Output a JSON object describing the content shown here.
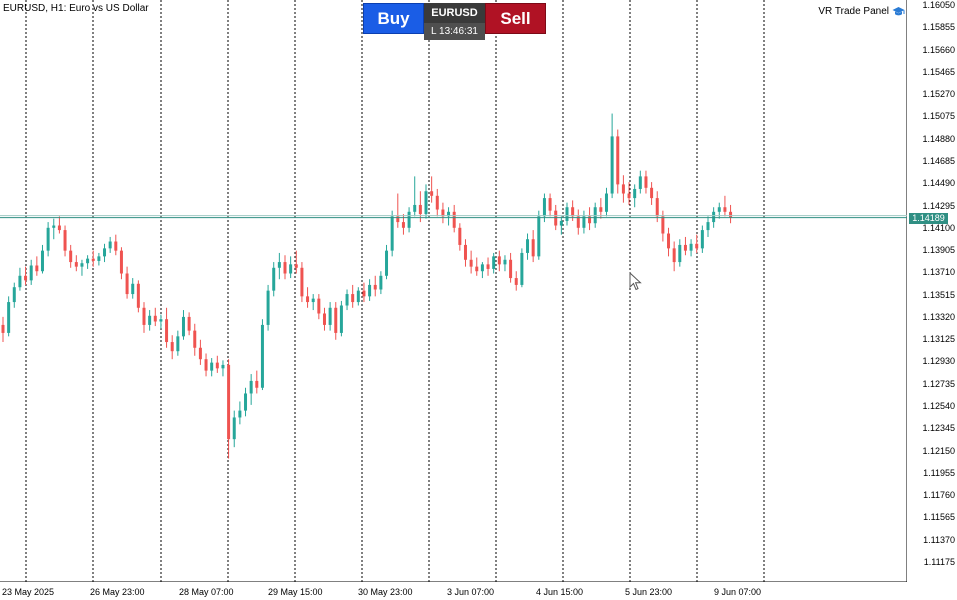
{
  "header": {
    "symbol_title": "EURUSD, H1:  Euro vs US Dollar",
    "panel_title": "VR Trade Panel",
    "panel_icon": "graduation-cap-icon"
  },
  "trade_panel": {
    "buy_label": "Buy",
    "sell_label": "Sell",
    "symbol": "EURUSD",
    "time": "L 13:46:31",
    "buy_color": "#1a5de6",
    "sell_color": "#b01224"
  },
  "price_axis": [
    "1.16050",
    "1.15855",
    "1.15660",
    "1.15465",
    "1.15270",
    "1.15075",
    "1.14880",
    "1.14685",
    "1.14490",
    "1.14295",
    "1.14100",
    "1.13905",
    "1.13710",
    "1.13515",
    "1.13320",
    "1.13125",
    "1.12930",
    "1.12735",
    "1.12540",
    "1.12345",
    "1.12150",
    "1.11955",
    "1.11760",
    "1.11565",
    "1.11370",
    "1.11175"
  ],
  "current_price": "1.14189",
  "current_price_color": "#2f8f83",
  "date_axis": [
    "23 May 2025",
    "26 May 23:00",
    "28 May 07:00",
    "29 May 15:00",
    "30 May 23:00",
    "3 Jun 07:00",
    "4 Jun 15:00",
    "5 Jun 23:00",
    "9 Jun 07:00"
  ],
  "chart_data": {
    "type": "candlestick",
    "symbol": "EURUSD",
    "timeframe": "H1",
    "bull_color": "#26a69a",
    "bear_color": "#ef5350",
    "ylim": [
      1.11,
      1.161
    ],
    "candles": [
      {
        "o": 1.1325,
        "h": 1.1332,
        "l": 1.131,
        "c": 1.1318
      },
      {
        "o": 1.1318,
        "h": 1.135,
        "l": 1.1315,
        "c": 1.1345
      },
      {
        "o": 1.1345,
        "h": 1.1362,
        "l": 1.134,
        "c": 1.1358
      },
      {
        "o": 1.1358,
        "h": 1.1375,
        "l": 1.1355,
        "c": 1.1368
      },
      {
        "o": 1.1368,
        "h": 1.1376,
        "l": 1.136,
        "c": 1.1364
      },
      {
        "o": 1.1364,
        "h": 1.1382,
        "l": 1.136,
        "c": 1.1377
      },
      {
        "o": 1.1377,
        "h": 1.1385,
        "l": 1.1368,
        "c": 1.1372
      },
      {
        "o": 1.1372,
        "h": 1.1395,
        "l": 1.137,
        "c": 1.139
      },
      {
        "o": 1.139,
        "h": 1.1415,
        "l": 1.1385,
        "c": 1.141
      },
      {
        "o": 1.141,
        "h": 1.1418,
        "l": 1.14,
        "c": 1.1412
      },
      {
        "o": 1.1412,
        "h": 1.142,
        "l": 1.1405,
        "c": 1.1408
      },
      {
        "o": 1.1408,
        "h": 1.1412,
        "l": 1.1385,
        "c": 1.139
      },
      {
        "o": 1.139,
        "h": 1.1395,
        "l": 1.1375,
        "c": 1.138
      },
      {
        "o": 1.138,
        "h": 1.1386,
        "l": 1.1372,
        "c": 1.1376
      },
      {
        "o": 1.1376,
        "h": 1.1382,
        "l": 1.1368,
        "c": 1.1379
      },
      {
        "o": 1.1379,
        "h": 1.1386,
        "l": 1.1374,
        "c": 1.1383
      },
      {
        "o": 1.1383,
        "h": 1.139,
        "l": 1.1376,
        "c": 1.1381
      },
      {
        "o": 1.1381,
        "h": 1.1388,
        "l": 1.1377,
        "c": 1.1385
      },
      {
        "o": 1.1385,
        "h": 1.1396,
        "l": 1.138,
        "c": 1.1392
      },
      {
        "o": 1.1392,
        "h": 1.1402,
        "l": 1.1388,
        "c": 1.1398
      },
      {
        "o": 1.1398,
        "h": 1.1404,
        "l": 1.1386,
        "c": 1.139
      },
      {
        "o": 1.139,
        "h": 1.1393,
        "l": 1.1365,
        "c": 1.137
      },
      {
        "o": 1.137,
        "h": 1.1376,
        "l": 1.1348,
        "c": 1.1352
      },
      {
        "o": 1.1352,
        "h": 1.1366,
        "l": 1.1348,
        "c": 1.1361
      },
      {
        "o": 1.1361,
        "h": 1.1364,
        "l": 1.1336,
        "c": 1.134
      },
      {
        "o": 1.134,
        "h": 1.1345,
        "l": 1.1318,
        "c": 1.1325
      },
      {
        "o": 1.1325,
        "h": 1.1338,
        "l": 1.132,
        "c": 1.1333
      },
      {
        "o": 1.1333,
        "h": 1.134,
        "l": 1.1324,
        "c": 1.1328
      },
      {
        "o": 1.1328,
        "h": 1.1334,
        "l": 1.1322,
        "c": 1.133
      },
      {
        "o": 1.133,
        "h": 1.134,
        "l": 1.1305,
        "c": 1.131
      },
      {
        "o": 1.131,
        "h": 1.1316,
        "l": 1.1295,
        "c": 1.1302
      },
      {
        "o": 1.1302,
        "h": 1.132,
        "l": 1.1298,
        "c": 1.1315
      },
      {
        "o": 1.1315,
        "h": 1.1338,
        "l": 1.1312,
        "c": 1.1332
      },
      {
        "o": 1.1332,
        "h": 1.1336,
        "l": 1.1316,
        "c": 1.132
      },
      {
        "o": 1.132,
        "h": 1.1326,
        "l": 1.1298,
        "c": 1.1305
      },
      {
        "o": 1.1305,
        "h": 1.1312,
        "l": 1.129,
        "c": 1.1295
      },
      {
        "o": 1.1295,
        "h": 1.13,
        "l": 1.128,
        "c": 1.1285
      },
      {
        "o": 1.1285,
        "h": 1.1296,
        "l": 1.128,
        "c": 1.1292
      },
      {
        "o": 1.1292,
        "h": 1.1298,
        "l": 1.1283,
        "c": 1.1287
      },
      {
        "o": 1.1287,
        "h": 1.1294,
        "l": 1.128,
        "c": 1.129
      },
      {
        "o": 1.129,
        "h": 1.1295,
        "l": 1.1208,
        "c": 1.1225
      },
      {
        "o": 1.1225,
        "h": 1.125,
        "l": 1.1218,
        "c": 1.1244
      },
      {
        "o": 1.1244,
        "h": 1.1258,
        "l": 1.1238,
        "c": 1.125
      },
      {
        "o": 1.125,
        "h": 1.127,
        "l": 1.1245,
        "c": 1.1265
      },
      {
        "o": 1.1265,
        "h": 1.1282,
        "l": 1.1255,
        "c": 1.1276
      },
      {
        "o": 1.1276,
        "h": 1.1285,
        "l": 1.1265,
        "c": 1.127
      },
      {
        "o": 1.127,
        "h": 1.133,
        "l": 1.1268,
        "c": 1.1325
      },
      {
        "o": 1.1325,
        "h": 1.136,
        "l": 1.132,
        "c": 1.1355
      },
      {
        "o": 1.1355,
        "h": 1.138,
        "l": 1.135,
        "c": 1.1375
      },
      {
        "o": 1.1375,
        "h": 1.1388,
        "l": 1.1365,
        "c": 1.138
      },
      {
        "o": 1.138,
        "h": 1.1386,
        "l": 1.1365,
        "c": 1.137
      },
      {
        "o": 1.137,
        "h": 1.1385,
        "l": 1.1366,
        "c": 1.1378
      },
      {
        "o": 1.1378,
        "h": 1.139,
        "l": 1.137,
        "c": 1.1375
      },
      {
        "o": 1.1375,
        "h": 1.138,
        "l": 1.1345,
        "c": 1.135
      },
      {
        "o": 1.135,
        "h": 1.1358,
        "l": 1.134,
        "c": 1.1345
      },
      {
        "o": 1.1345,
        "h": 1.1352,
        "l": 1.1338,
        "c": 1.1348
      },
      {
        "o": 1.1348,
        "h": 1.1352,
        "l": 1.133,
        "c": 1.1335
      },
      {
        "o": 1.1335,
        "h": 1.134,
        "l": 1.132,
        "c": 1.1325
      },
      {
        "o": 1.1325,
        "h": 1.1345,
        "l": 1.132,
        "c": 1.134
      },
      {
        "o": 1.134,
        "h": 1.1345,
        "l": 1.1312,
        "c": 1.1318
      },
      {
        "o": 1.1318,
        "h": 1.1346,
        "l": 1.1315,
        "c": 1.1342
      },
      {
        "o": 1.1342,
        "h": 1.1356,
        "l": 1.1338,
        "c": 1.1352
      },
      {
        "o": 1.1352,
        "h": 1.136,
        "l": 1.134,
        "c": 1.1345
      },
      {
        "o": 1.1345,
        "h": 1.1358,
        "l": 1.1342,
        "c": 1.1355
      },
      {
        "o": 1.1355,
        "h": 1.1362,
        "l": 1.1345,
        "c": 1.135
      },
      {
        "o": 1.135,
        "h": 1.1365,
        "l": 1.1346,
        "c": 1.136
      },
      {
        "o": 1.136,
        "h": 1.1368,
        "l": 1.135,
        "c": 1.1356
      },
      {
        "o": 1.1356,
        "h": 1.1372,
        "l": 1.1352,
        "c": 1.1368
      },
      {
        "o": 1.1368,
        "h": 1.1395,
        "l": 1.1365,
        "c": 1.139
      },
      {
        "o": 1.139,
        "h": 1.1425,
        "l": 1.1385,
        "c": 1.142
      },
      {
        "o": 1.142,
        "h": 1.144,
        "l": 1.141,
        "c": 1.1415
      },
      {
        "o": 1.1415,
        "h": 1.1422,
        "l": 1.1404,
        "c": 1.141
      },
      {
        "o": 1.141,
        "h": 1.1428,
        "l": 1.1406,
        "c": 1.1424
      },
      {
        "o": 1.1424,
        "h": 1.1455,
        "l": 1.142,
        "c": 1.143
      },
      {
        "o": 1.143,
        "h": 1.1442,
        "l": 1.1415,
        "c": 1.1422
      },
      {
        "o": 1.1422,
        "h": 1.1448,
        "l": 1.1418,
        "c": 1.1442
      },
      {
        "o": 1.1442,
        "h": 1.1455,
        "l": 1.1432,
        "c": 1.1438
      },
      {
        "o": 1.1438,
        "h": 1.1444,
        "l": 1.142,
        "c": 1.1426
      },
      {
        "o": 1.1426,
        "h": 1.1432,
        "l": 1.1414,
        "c": 1.142
      },
      {
        "o": 1.142,
        "h": 1.1428,
        "l": 1.1412,
        "c": 1.1424
      },
      {
        "o": 1.1424,
        "h": 1.143,
        "l": 1.1406,
        "c": 1.141
      },
      {
        "o": 1.141,
        "h": 1.1414,
        "l": 1.139,
        "c": 1.1395
      },
      {
        "o": 1.1395,
        "h": 1.14,
        "l": 1.1376,
        "c": 1.1382
      },
      {
        "o": 1.1382,
        "h": 1.139,
        "l": 1.137,
        "c": 1.1376
      },
      {
        "o": 1.1376,
        "h": 1.1384,
        "l": 1.1368,
        "c": 1.1372
      },
      {
        "o": 1.1372,
        "h": 1.138,
        "l": 1.1366,
        "c": 1.1378
      },
      {
        "o": 1.1378,
        "h": 1.1384,
        "l": 1.1368,
        "c": 1.1374
      },
      {
        "o": 1.1374,
        "h": 1.1388,
        "l": 1.137,
        "c": 1.1385
      },
      {
        "o": 1.1385,
        "h": 1.139,
        "l": 1.1372,
        "c": 1.1378
      },
      {
        "o": 1.1378,
        "h": 1.1386,
        "l": 1.1372,
        "c": 1.1382
      },
      {
        "o": 1.1382,
        "h": 1.1388,
        "l": 1.1362,
        "c": 1.1366
      },
      {
        "o": 1.1366,
        "h": 1.1372,
        "l": 1.1355,
        "c": 1.136
      },
      {
        "o": 1.136,
        "h": 1.1392,
        "l": 1.1358,
        "c": 1.1388
      },
      {
        "o": 1.1388,
        "h": 1.1405,
        "l": 1.1382,
        "c": 1.14
      },
      {
        "o": 1.14,
        "h": 1.1408,
        "l": 1.138,
        "c": 1.1385
      },
      {
        "o": 1.1385,
        "h": 1.1425,
        "l": 1.1382,
        "c": 1.142
      },
      {
        "o": 1.142,
        "h": 1.144,
        "l": 1.1415,
        "c": 1.1436
      },
      {
        "o": 1.1436,
        "h": 1.144,
        "l": 1.142,
        "c": 1.1425
      },
      {
        "o": 1.1425,
        "h": 1.143,
        "l": 1.1408,
        "c": 1.1412
      },
      {
        "o": 1.1412,
        "h": 1.142,
        "l": 1.1404,
        "c": 1.1416
      },
      {
        "o": 1.1416,
        "h": 1.1432,
        "l": 1.1412,
        "c": 1.1428
      },
      {
        "o": 1.1428,
        "h": 1.1434,
        "l": 1.1416,
        "c": 1.142
      },
      {
        "o": 1.142,
        "h": 1.1426,
        "l": 1.1404,
        "c": 1.141
      },
      {
        "o": 1.141,
        "h": 1.1425,
        "l": 1.1405,
        "c": 1.142
      },
      {
        "o": 1.142,
        "h": 1.1428,
        "l": 1.1408,
        "c": 1.1414
      },
      {
        "o": 1.1414,
        "h": 1.1432,
        "l": 1.141,
        "c": 1.1428
      },
      {
        "o": 1.1428,
        "h": 1.1436,
        "l": 1.1418,
        "c": 1.1424
      },
      {
        "o": 1.1424,
        "h": 1.1445,
        "l": 1.142,
        "c": 1.144
      },
      {
        "o": 1.144,
        "h": 1.151,
        "l": 1.1436,
        "c": 1.149
      },
      {
        "o": 1.149,
        "h": 1.1496,
        "l": 1.144,
        "c": 1.1448
      },
      {
        "o": 1.1448,
        "h": 1.1456,
        "l": 1.1432,
        "c": 1.144
      },
      {
        "o": 1.144,
        "h": 1.145,
        "l": 1.143,
        "c": 1.1436
      },
      {
        "o": 1.1436,
        "h": 1.1448,
        "l": 1.1428,
        "c": 1.1444
      },
      {
        "o": 1.1444,
        "h": 1.146,
        "l": 1.144,
        "c": 1.1455
      },
      {
        "o": 1.1455,
        "h": 1.146,
        "l": 1.144,
        "c": 1.1445
      },
      {
        "o": 1.1445,
        "h": 1.145,
        "l": 1.143,
        "c": 1.1436
      },
      {
        "o": 1.1436,
        "h": 1.1442,
        "l": 1.1415,
        "c": 1.142
      },
      {
        "o": 1.142,
        "h": 1.1425,
        "l": 1.1398,
        "c": 1.1405
      },
      {
        "o": 1.1405,
        "h": 1.141,
        "l": 1.1385,
        "c": 1.1392
      },
      {
        "o": 1.1392,
        "h": 1.1398,
        "l": 1.1372,
        "c": 1.138
      },
      {
        "o": 1.138,
        "h": 1.14,
        "l": 1.1376,
        "c": 1.1395
      },
      {
        "o": 1.1395,
        "h": 1.1402,
        "l": 1.1386,
        "c": 1.139
      },
      {
        "o": 1.139,
        "h": 1.14,
        "l": 1.1385,
        "c": 1.1396
      },
      {
        "o": 1.1396,
        "h": 1.1404,
        "l": 1.1388,
        "c": 1.1392
      },
      {
        "o": 1.1392,
        "h": 1.1412,
        "l": 1.1388,
        "c": 1.1408
      },
      {
        "o": 1.1408,
        "h": 1.142,
        "l": 1.1402,
        "c": 1.1415
      },
      {
        "o": 1.1415,
        "h": 1.1428,
        "l": 1.141,
        "c": 1.1424
      },
      {
        "o": 1.1424,
        "h": 1.1432,
        "l": 1.1418,
        "c": 1.1428
      },
      {
        "o": 1.1428,
        "h": 1.1438,
        "l": 1.142,
        "c": 1.1424
      },
      {
        "o": 1.1424,
        "h": 1.143,
        "l": 1.1414,
        "c": 1.1419
      }
    ]
  }
}
